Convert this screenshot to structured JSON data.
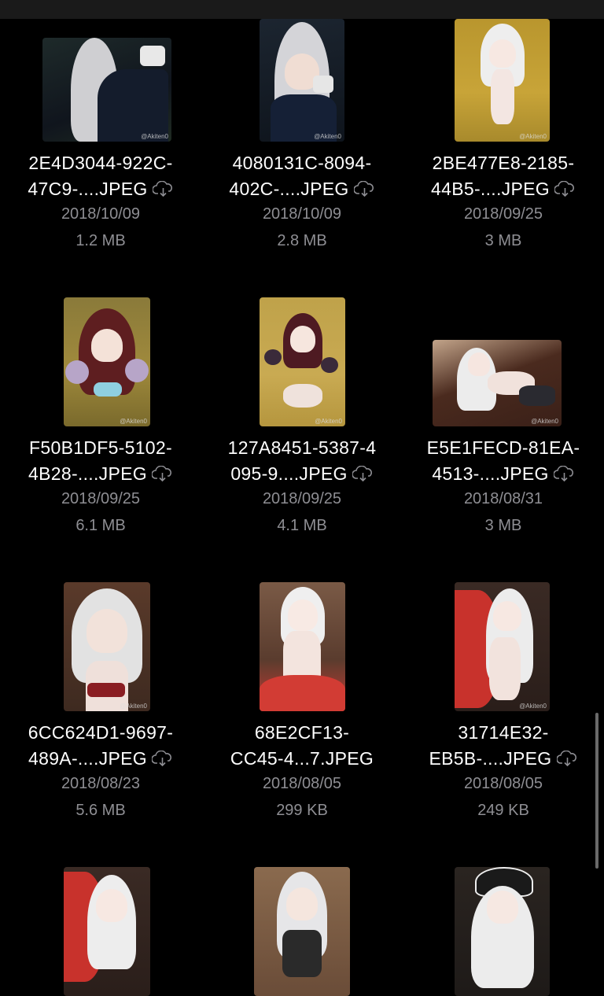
{
  "files": [
    {
      "name_line1": "2E4D3044-922C-",
      "name_line2": "47C9-....JPEG",
      "date": "2018/10/09",
      "size": "1.2 MB",
      "cloud": true,
      "watermark": "@Akiten0"
    },
    {
      "name_line1": "4080131C-8094-",
      "name_line2": "402C-....JPEG",
      "date": "2018/10/09",
      "size": "2.8 MB",
      "cloud": true,
      "watermark": "@Akiten0"
    },
    {
      "name_line1": "2BE477E8-2185-",
      "name_line2": "44B5-....JPEG",
      "date": "2018/09/25",
      "size": "3 MB",
      "cloud": true,
      "watermark": "@Akiten0"
    },
    {
      "name_line1": "F50B1DF5-5102-",
      "name_line2": "4B28-....JPEG",
      "date": "2018/09/25",
      "size": "6.1 MB",
      "cloud": true,
      "watermark": "@Akiten0"
    },
    {
      "name_line1": "127A8451-5387-4",
      "name_line2": "095-9....JPEG",
      "date": "2018/09/25",
      "size": "4.1 MB",
      "cloud": true,
      "watermark": "@Akiten0"
    },
    {
      "name_line1": "E5E1FECD-81EA-",
      "name_line2": "4513-....JPEG",
      "date": "2018/08/31",
      "size": "3 MB",
      "cloud": true,
      "watermark": "@Akiten0"
    },
    {
      "name_line1": "6CC624D1-9697-",
      "name_line2": "489A-....JPEG",
      "date": "2018/08/23",
      "size": "5.6 MB",
      "cloud": true,
      "watermark": "@Akiten0"
    },
    {
      "name_line1": "68E2CF13-",
      "name_line2": "CC45-4...7.JPEG",
      "date": "2018/08/05",
      "size": "299 KB",
      "cloud": false,
      "watermark": ""
    },
    {
      "name_line1": "31714E32-",
      "name_line2": "EB5B-....JPEG",
      "date": "2018/08/05",
      "size": "249 KB",
      "cloud": true,
      "watermark": "@Akiten0"
    }
  ],
  "colors": {
    "background": "#000000",
    "text": "#ffffff",
    "secondary": "#8e8e93"
  },
  "icons": {
    "cloud": "cloud-download-icon"
  }
}
